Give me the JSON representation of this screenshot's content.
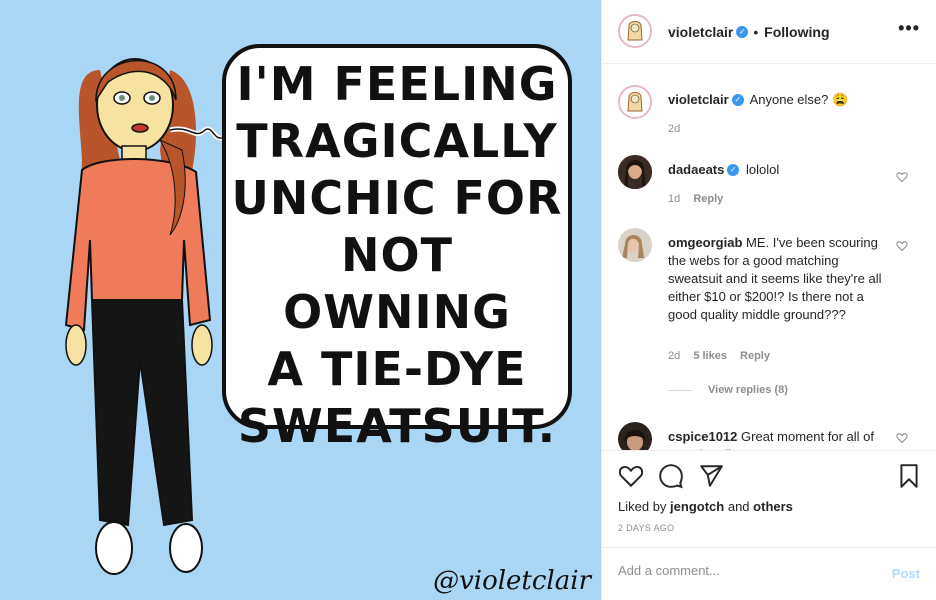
{
  "post": {
    "image": {
      "bubble_lines": [
        "I'M FEELING",
        "TRAGICALLY",
        "UNCHIC FOR",
        "NOT OWNING",
        "A TIE-DYE",
        "SWEATSUIT."
      ],
      "signature": "@violetclair",
      "background_color": "#a9d6f5"
    },
    "header": {
      "username": "violetclair",
      "separator": "•",
      "follow_status": "Following",
      "more_label": "•••"
    },
    "caption": {
      "username": "violetclair",
      "text": "Anyone else? 😩",
      "time": "2d"
    },
    "comments": [
      {
        "username": "dadaeats",
        "verified": true,
        "text": "lololol",
        "time": "1d",
        "reply_label": "Reply"
      },
      {
        "username": "omgeorgiab",
        "verified": false,
        "text": "ME. I've been scouring the webs for a good matching sweatsuit and it seems like they're all either $10 or $200!? Is there not a good quality middle ground???",
        "time": "2d",
        "likes": "5 likes",
        "reply_label": "Reply",
        "view_replies": "View replies (8)"
      },
      {
        "username": "cspice1012",
        "verified": false,
        "text": "Great moment for all of us to be alive",
        "time": ""
      }
    ],
    "actions": {
      "liked_prefix": "Liked by",
      "liked_user": "jengotch",
      "liked_suffix": "and",
      "liked_others": "others",
      "date": "2 DAYS AGO"
    },
    "add_comment": {
      "placeholder": "Add a comment...",
      "post_label": "Post"
    },
    "colors": {
      "verified_blue": "#3897f0",
      "post_disabled": "#b3dbff",
      "meta_gray": "#8e8e8e"
    }
  }
}
